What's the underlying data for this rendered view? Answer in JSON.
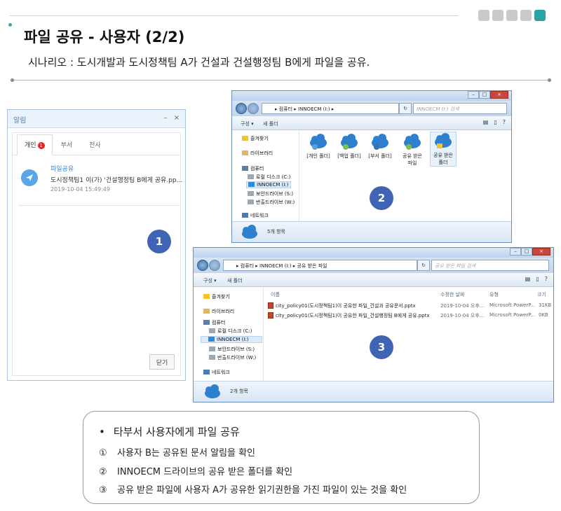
{
  "header": {
    "title": "파일 공유 - 사용자 (2/2)",
    "scenario": "시나리오 : 도시개발과 도시정책팀 A가 건설과 건설행정팀 B에게 파일을 공유."
  },
  "notification": {
    "window_title": "알림",
    "minimize": "–",
    "close": "×",
    "tabs": [
      {
        "label": "개인",
        "badge": "1"
      },
      {
        "label": "부서"
      },
      {
        "label": "전사"
      }
    ],
    "item": {
      "category": "파일공유",
      "message": "도시정책팀1 이(가) '건설행정팀 B에게 공유.pp...",
      "timestamp": "2019-10-04 15:49:49"
    },
    "close_button": "닫기"
  },
  "explorer1": {
    "address": "▸ 컴퓨터 ▸ INNOECM (I:) ▸",
    "search_placeholder": "INNOECM (I:) 검색",
    "toolbar": {
      "organize": "구성 ▾",
      "new_folder": "새 폴더"
    },
    "nav": {
      "favorites": "즐겨찾기",
      "libraries": "라이브러리",
      "computer": "컴퓨터",
      "local_disk": "로컬 디스크 (C:)",
      "innoecm": "INNOECM (I:)",
      "secure": "보안드라이브 (S:)",
      "export": "반출드라이브 (W:)",
      "network": "네트워크"
    },
    "folders": [
      {
        "line1": "[개인 폴더]",
        "line2": ""
      },
      {
        "line1": "[백업 폴더]",
        "line2": ""
      },
      {
        "line1": "[부서 폴더]",
        "line2": ""
      },
      {
        "line1": "공유 받은",
        "line2": "파일"
      },
      {
        "line1": "공유 받은",
        "line2": "폴더"
      }
    ],
    "status": "5개 항목"
  },
  "explorer2": {
    "address": "▸ 컴퓨터 ▸ INNOECM (I:) ▸ 공유 받은 파일",
    "search_placeholder": "공유 받은 파일 검색",
    "toolbar": {
      "organize": "구성 ▾",
      "new_folder": "새 폴더"
    },
    "nav": {
      "favorites": "즐겨찾기",
      "libraries": "라이브러리",
      "computer": "컴퓨터",
      "local_disk": "로컬 디스크 (C:)",
      "innoecm": "INNOECM (I:)",
      "secure": "보안드라이브 (S:)",
      "export": "반출드라이브 (W:)",
      "network": "네트워크"
    },
    "columns": {
      "name": "이름",
      "modified": "수정한 날짜",
      "type": "유형",
      "size": "크기"
    },
    "files": [
      {
        "name": "city_policy01(도시정책팀1)이 공유한 파일_건설과 공유문서.pptx",
        "modified": "2019-10-04 오후...",
        "type": "Microsoft PowerP...",
        "size": "31KB"
      },
      {
        "name": "city_policy01(도시정책팀1)이 공유한 파일_건설행정팀 B에게 공유.pptx",
        "modified": "2019-10-04 오후...",
        "type": "Microsoft PowerP...",
        "size": "0KB"
      }
    ],
    "status": "2개 항목"
  },
  "steps": [
    "1",
    "2",
    "3"
  ],
  "summary": {
    "bullet": "•",
    "heading": "타부서 사용자에게 파일 공유",
    "items": [
      {
        "num": "①",
        "text": "사용자 B는 공유된 문서 알림을 확인"
      },
      {
        "num": "②",
        "text": "INNOECM 드라이브의 공유 받은 폴더를 확인"
      },
      {
        "num": "③",
        "text": "공유 받은 파일에 사용자 A가 공유한 읽기권한을 가진 파일이 있는 것을 확인"
      }
    ]
  },
  "colors": {
    "accent": "#2aa3a3",
    "step": "#3f64b4",
    "badge": "#e02626",
    "link": "#3a86d6"
  }
}
